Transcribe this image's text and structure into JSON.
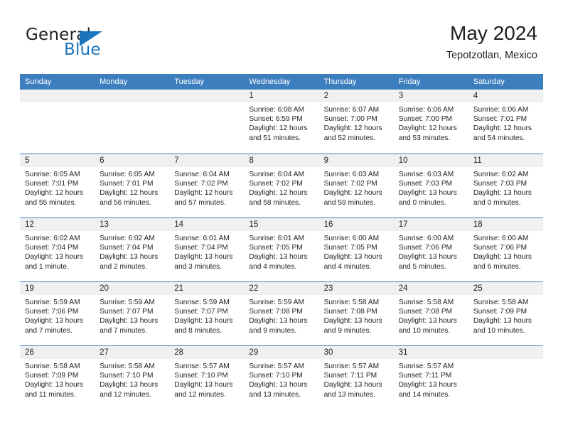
{
  "brand": {
    "name_part1": "General",
    "name_part2": "Blue",
    "accent_color": "#1a74bb"
  },
  "header": {
    "month_title": "May 2024",
    "location": "Tepotzotlan, Mexico"
  },
  "theme": {
    "header_blue": "#3d7ebf",
    "day_band_gray": "#f0f0f0",
    "text_color": "#231f20"
  },
  "weekdays": [
    "Sunday",
    "Monday",
    "Tuesday",
    "Wednesday",
    "Thursday",
    "Friday",
    "Saturday"
  ],
  "weeks": [
    [
      {
        "day": "",
        "empty": true,
        "sunrise": "",
        "sunset": "",
        "daylight_line1": "",
        "daylight_line2": ""
      },
      {
        "day": "",
        "empty": true,
        "sunrise": "",
        "sunset": "",
        "daylight_line1": "",
        "daylight_line2": ""
      },
      {
        "day": "",
        "empty": true,
        "sunrise": "",
        "sunset": "",
        "daylight_line1": "",
        "daylight_line2": ""
      },
      {
        "day": "1",
        "empty": false,
        "sunrise": "Sunrise: 6:08 AM",
        "sunset": "Sunset: 6:59 PM",
        "daylight_line1": "Daylight: 12 hours",
        "daylight_line2": "and 51 minutes."
      },
      {
        "day": "2",
        "empty": false,
        "sunrise": "Sunrise: 6:07 AM",
        "sunset": "Sunset: 7:00 PM",
        "daylight_line1": "Daylight: 12 hours",
        "daylight_line2": "and 52 minutes."
      },
      {
        "day": "3",
        "empty": false,
        "sunrise": "Sunrise: 6:06 AM",
        "sunset": "Sunset: 7:00 PM",
        "daylight_line1": "Daylight: 12 hours",
        "daylight_line2": "and 53 minutes."
      },
      {
        "day": "4",
        "empty": false,
        "sunrise": "Sunrise: 6:06 AM",
        "sunset": "Sunset: 7:01 PM",
        "daylight_line1": "Daylight: 12 hours",
        "daylight_line2": "and 54 minutes."
      }
    ],
    [
      {
        "day": "5",
        "empty": false,
        "sunrise": "Sunrise: 6:05 AM",
        "sunset": "Sunset: 7:01 PM",
        "daylight_line1": "Daylight: 12 hours",
        "daylight_line2": "and 55 minutes."
      },
      {
        "day": "6",
        "empty": false,
        "sunrise": "Sunrise: 6:05 AM",
        "sunset": "Sunset: 7:01 PM",
        "daylight_line1": "Daylight: 12 hours",
        "daylight_line2": "and 56 minutes."
      },
      {
        "day": "7",
        "empty": false,
        "sunrise": "Sunrise: 6:04 AM",
        "sunset": "Sunset: 7:02 PM",
        "daylight_line1": "Daylight: 12 hours",
        "daylight_line2": "and 57 minutes."
      },
      {
        "day": "8",
        "empty": false,
        "sunrise": "Sunrise: 6:04 AM",
        "sunset": "Sunset: 7:02 PM",
        "daylight_line1": "Daylight: 12 hours",
        "daylight_line2": "and 58 minutes."
      },
      {
        "day": "9",
        "empty": false,
        "sunrise": "Sunrise: 6:03 AM",
        "sunset": "Sunset: 7:02 PM",
        "daylight_line1": "Daylight: 12 hours",
        "daylight_line2": "and 59 minutes."
      },
      {
        "day": "10",
        "empty": false,
        "sunrise": "Sunrise: 6:03 AM",
        "sunset": "Sunset: 7:03 PM",
        "daylight_line1": "Daylight: 13 hours",
        "daylight_line2": "and 0 minutes."
      },
      {
        "day": "11",
        "empty": false,
        "sunrise": "Sunrise: 6:02 AM",
        "sunset": "Sunset: 7:03 PM",
        "daylight_line1": "Daylight: 13 hours",
        "daylight_line2": "and 0 minutes."
      }
    ],
    [
      {
        "day": "12",
        "empty": false,
        "sunrise": "Sunrise: 6:02 AM",
        "sunset": "Sunset: 7:04 PM",
        "daylight_line1": "Daylight: 13 hours",
        "daylight_line2": "and 1 minute."
      },
      {
        "day": "13",
        "empty": false,
        "sunrise": "Sunrise: 6:02 AM",
        "sunset": "Sunset: 7:04 PM",
        "daylight_line1": "Daylight: 13 hours",
        "daylight_line2": "and 2 minutes."
      },
      {
        "day": "14",
        "empty": false,
        "sunrise": "Sunrise: 6:01 AM",
        "sunset": "Sunset: 7:04 PM",
        "daylight_line1": "Daylight: 13 hours",
        "daylight_line2": "and 3 minutes."
      },
      {
        "day": "15",
        "empty": false,
        "sunrise": "Sunrise: 6:01 AM",
        "sunset": "Sunset: 7:05 PM",
        "daylight_line1": "Daylight: 13 hours",
        "daylight_line2": "and 4 minutes."
      },
      {
        "day": "16",
        "empty": false,
        "sunrise": "Sunrise: 6:00 AM",
        "sunset": "Sunset: 7:05 PM",
        "daylight_line1": "Daylight: 13 hours",
        "daylight_line2": "and 4 minutes."
      },
      {
        "day": "17",
        "empty": false,
        "sunrise": "Sunrise: 6:00 AM",
        "sunset": "Sunset: 7:06 PM",
        "daylight_line1": "Daylight: 13 hours",
        "daylight_line2": "and 5 minutes."
      },
      {
        "day": "18",
        "empty": false,
        "sunrise": "Sunrise: 6:00 AM",
        "sunset": "Sunset: 7:06 PM",
        "daylight_line1": "Daylight: 13 hours",
        "daylight_line2": "and 6 minutes."
      }
    ],
    [
      {
        "day": "19",
        "empty": false,
        "sunrise": "Sunrise: 5:59 AM",
        "sunset": "Sunset: 7:06 PM",
        "daylight_line1": "Daylight: 13 hours",
        "daylight_line2": "and 7 minutes."
      },
      {
        "day": "20",
        "empty": false,
        "sunrise": "Sunrise: 5:59 AM",
        "sunset": "Sunset: 7:07 PM",
        "daylight_line1": "Daylight: 13 hours",
        "daylight_line2": "and 7 minutes."
      },
      {
        "day": "21",
        "empty": false,
        "sunrise": "Sunrise: 5:59 AM",
        "sunset": "Sunset: 7:07 PM",
        "daylight_line1": "Daylight: 13 hours",
        "daylight_line2": "and 8 minutes."
      },
      {
        "day": "22",
        "empty": false,
        "sunrise": "Sunrise: 5:59 AM",
        "sunset": "Sunset: 7:08 PM",
        "daylight_line1": "Daylight: 13 hours",
        "daylight_line2": "and 9 minutes."
      },
      {
        "day": "23",
        "empty": false,
        "sunrise": "Sunrise: 5:58 AM",
        "sunset": "Sunset: 7:08 PM",
        "daylight_line1": "Daylight: 13 hours",
        "daylight_line2": "and 9 minutes."
      },
      {
        "day": "24",
        "empty": false,
        "sunrise": "Sunrise: 5:58 AM",
        "sunset": "Sunset: 7:08 PM",
        "daylight_line1": "Daylight: 13 hours",
        "daylight_line2": "and 10 minutes."
      },
      {
        "day": "25",
        "empty": false,
        "sunrise": "Sunrise: 5:58 AM",
        "sunset": "Sunset: 7:09 PM",
        "daylight_line1": "Daylight: 13 hours",
        "daylight_line2": "and 10 minutes."
      }
    ],
    [
      {
        "day": "26",
        "empty": false,
        "sunrise": "Sunrise: 5:58 AM",
        "sunset": "Sunset: 7:09 PM",
        "daylight_line1": "Daylight: 13 hours",
        "daylight_line2": "and 11 minutes."
      },
      {
        "day": "27",
        "empty": false,
        "sunrise": "Sunrise: 5:58 AM",
        "sunset": "Sunset: 7:10 PM",
        "daylight_line1": "Daylight: 13 hours",
        "daylight_line2": "and 12 minutes."
      },
      {
        "day": "28",
        "empty": false,
        "sunrise": "Sunrise: 5:57 AM",
        "sunset": "Sunset: 7:10 PM",
        "daylight_line1": "Daylight: 13 hours",
        "daylight_line2": "and 12 minutes."
      },
      {
        "day": "29",
        "empty": false,
        "sunrise": "Sunrise: 5:57 AM",
        "sunset": "Sunset: 7:10 PM",
        "daylight_line1": "Daylight: 13 hours",
        "daylight_line2": "and 13 minutes."
      },
      {
        "day": "30",
        "empty": false,
        "sunrise": "Sunrise: 5:57 AM",
        "sunset": "Sunset: 7:11 PM",
        "daylight_line1": "Daylight: 13 hours",
        "daylight_line2": "and 13 minutes."
      },
      {
        "day": "31",
        "empty": false,
        "sunrise": "Sunrise: 5:57 AM",
        "sunset": "Sunset: 7:11 PM",
        "daylight_line1": "Daylight: 13 hours",
        "daylight_line2": "and 14 minutes."
      },
      {
        "day": "",
        "empty": true,
        "sunrise": "",
        "sunset": "",
        "daylight_line1": "",
        "daylight_line2": ""
      }
    ]
  ]
}
